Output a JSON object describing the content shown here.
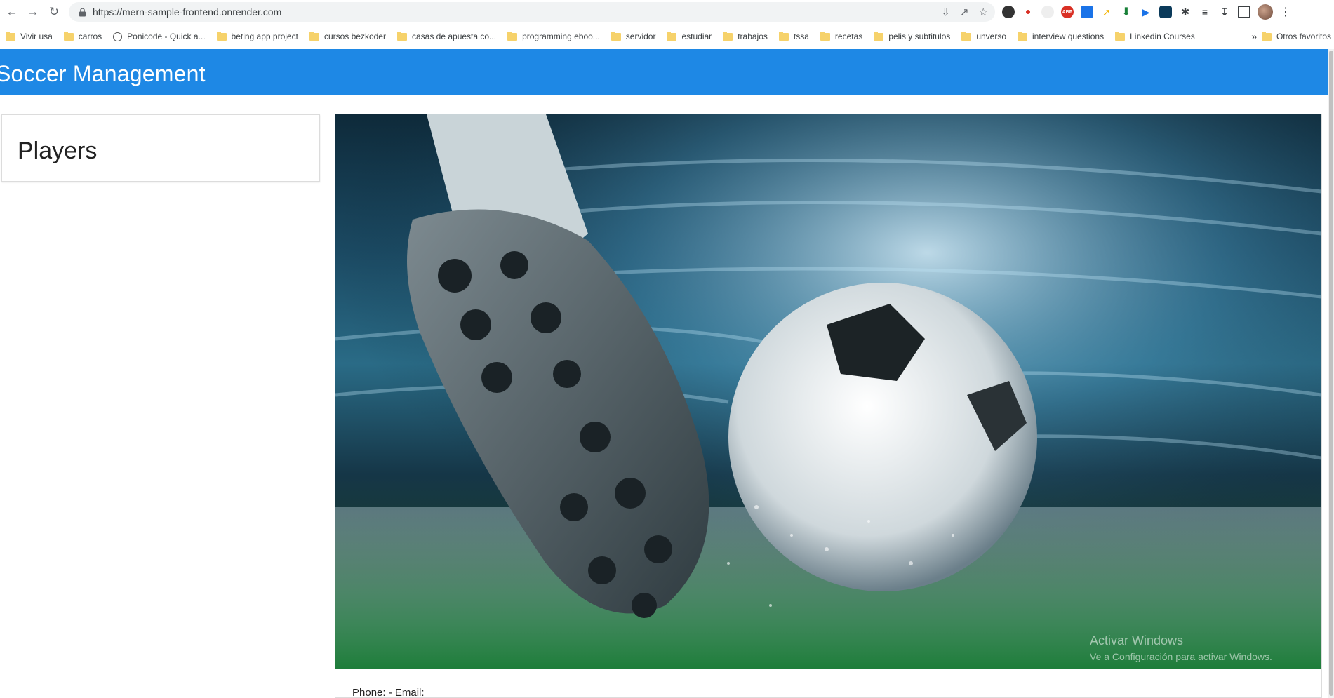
{
  "browser": {
    "url": "https://mern-sample-frontend.onrender.com",
    "bookmarks": [
      {
        "label": "Vivir usa",
        "icon": "folder-icon"
      },
      {
        "label": "carros",
        "icon": "folder-icon"
      },
      {
        "label": "Ponicode - Quick a...",
        "icon": "site-icon"
      },
      {
        "label": "beting app project",
        "icon": "folder-icon"
      },
      {
        "label": "cursos bezkoder",
        "icon": "folder-icon"
      },
      {
        "label": "casas de apuesta co...",
        "icon": "folder-icon"
      },
      {
        "label": "programming eboo...",
        "icon": "folder-icon"
      },
      {
        "label": "servidor",
        "icon": "folder-icon"
      },
      {
        "label": "estudiar",
        "icon": "folder-icon"
      },
      {
        "label": "trabajos",
        "icon": "folder-icon"
      },
      {
        "label": "tssa",
        "icon": "folder-icon"
      },
      {
        "label": "recetas",
        "icon": "folder-icon"
      },
      {
        "label": "pelis y subtitulos",
        "icon": "folder-icon"
      },
      {
        "label": "unverso",
        "icon": "folder-icon"
      },
      {
        "label": "interview questions",
        "icon": "folder-icon"
      },
      {
        "label": "Linkedin Courses",
        "icon": "folder-icon"
      }
    ],
    "bookmarks_overflow": "»",
    "other_bookmarks": "Otros favoritos"
  },
  "app": {
    "title": "Soccer Management",
    "accent_color": "#1e88e5"
  },
  "sidebar": {
    "title": "Players"
  },
  "main": {
    "image_alt_icon": "soccer-boot-ball-image",
    "contact_line": "Phone: - Email:"
  },
  "watermark": {
    "line1": "Activar Windows",
    "line2": "Ve a Configuración para activar Windows."
  }
}
